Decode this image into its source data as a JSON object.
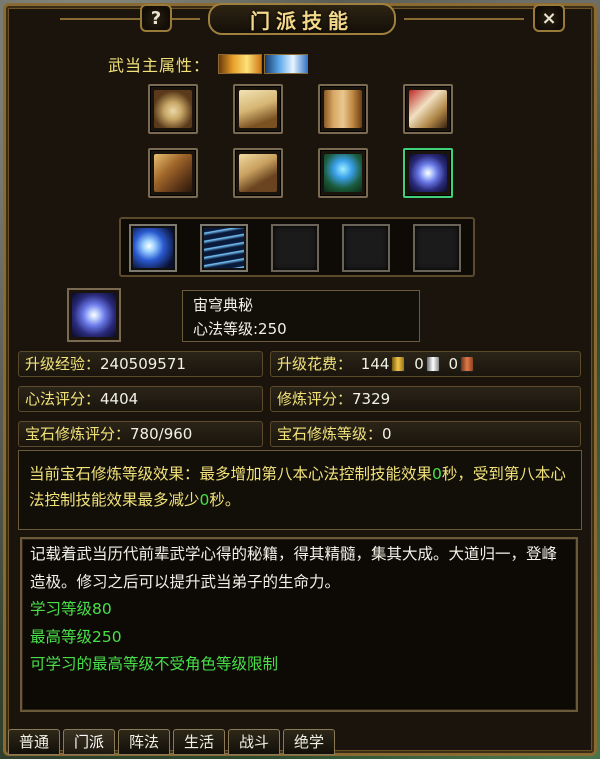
{
  "window": {
    "title": "门派技能",
    "help_label": "?",
    "close_label": "×"
  },
  "attribute": {
    "label": "武当主属性：",
    "icons": [
      "fire-element-icon",
      "water-element-icon"
    ]
  },
  "books": {
    "row1": [
      "taiji-scroll-icon",
      "open-book-icon",
      "bamboo-scroll-icon",
      "red-box-book-icon"
    ],
    "row2": [
      "sword-book-icon",
      "scroll-bundle-icon",
      "blue-swirl-book-icon",
      "galaxy-swirl-icon"
    ],
    "selected_index": 7
  },
  "skills": {
    "slots": [
      "lightning-figure-skill-icon",
      "tornado-skill-icon",
      "empty",
      "empty",
      "empty"
    ]
  },
  "selected": {
    "icon": "galaxy-swirl-icon",
    "name": "宙穹典秘",
    "level_text": "心法等级:250"
  },
  "stats": {
    "exp_label": "升级经验：",
    "exp_value": "240509571",
    "cost_label": "升级花费：",
    "cost_gold": "144",
    "cost_silver": "0",
    "cost_copper": "0",
    "xinfa_label": "心法评分：",
    "xinfa_value": "4404",
    "xiulian_label": "修炼评分：",
    "xiulian_value": "7329",
    "gem_score_label": "宝石修炼评分：",
    "gem_score_value": "780/960",
    "gem_level_label": "宝石修炼等级：",
    "gem_level_value": "0"
  },
  "effect": {
    "part1": "当前宝石修炼等级效果：最多增加第八本心法控制技能效果",
    "val1": "0",
    "part2": "秒，受到第八本心法控制技能效果最多减少",
    "val2": "0",
    "part3": "秒。"
  },
  "description": {
    "text": "记载着武当历代前辈武学心得的秘籍，得其精髓，集其大成。大道归一，登峰造极。修习之后可以提升武当弟子的生命力。",
    "learn_level": "学习等级80",
    "max_level": "最高等级250",
    "note": "可学习的最高等级不受角色等级限制"
  },
  "tabs": [
    "普通",
    "门派",
    "阵法",
    "生活",
    "战斗",
    "绝学"
  ],
  "active_tab": "门派",
  "colors": {
    "accent_gold": "#f1e27a",
    "title_gold": "#f4d88a",
    "green": "#48e048",
    "frame": "#8a6a33"
  }
}
